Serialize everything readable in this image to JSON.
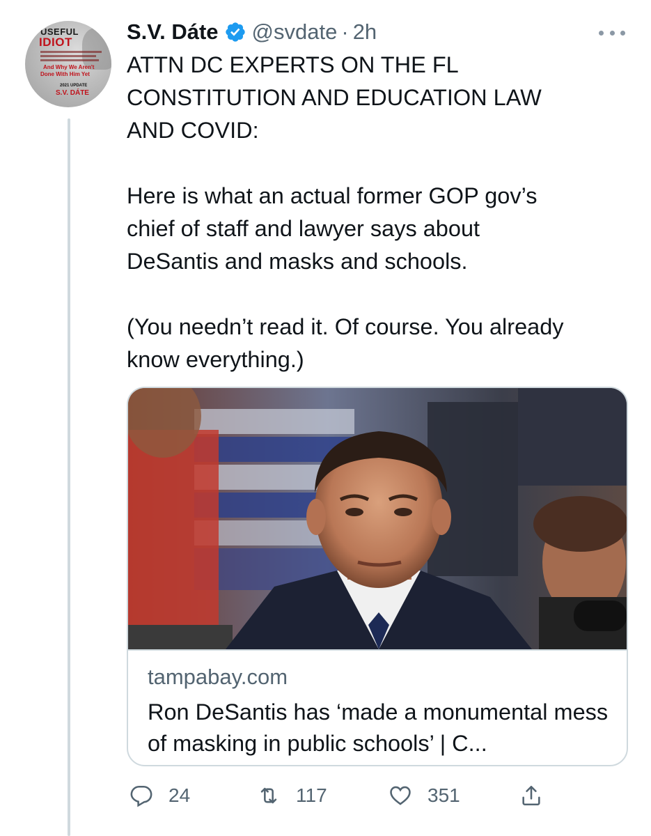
{
  "author": {
    "display_name": "S.V. Dáte",
    "handle": "@svdate",
    "separator": "·",
    "time": "2h",
    "verified": true,
    "avatar": {
      "book_title_1": "USEFUL",
      "book_title_2": "IDIOT",
      "subtitle_1": "And Why We Aren't",
      "subtitle_2": "Done With Him Yet",
      "edition": "2021 UPDATE",
      "author_name": "S.V. DÁTE"
    }
  },
  "tweet": {
    "text": "ATTN DC EXPERTS ON THE FL\nCONSTITUTION AND EDUCATION LAW\nAND COVID:\n\nHere is what an actual former GOP gov’s\nchief of staff and lawyer says about\nDeSantis and masks and schools.\n\n(You needn’t read it. Of course. You already\nknow everything.)"
  },
  "card": {
    "domain": "tampabay.com",
    "title": "Ron DeSantis has ‘made a monumental mess of masking in public schools’ | C..."
  },
  "actions": {
    "replies": "24",
    "retweets": "117",
    "likes": "351"
  },
  "icons": {
    "verified": "verified-badge-icon",
    "more": "more-options-icon",
    "reply": "reply-icon",
    "retweet": "retweet-icon",
    "like": "heart-icon",
    "share": "share-icon"
  },
  "colors": {
    "verified": "#1d9bf0",
    "secondary_text": "#536471",
    "border": "#cfd9de",
    "icon": "#536471"
  }
}
